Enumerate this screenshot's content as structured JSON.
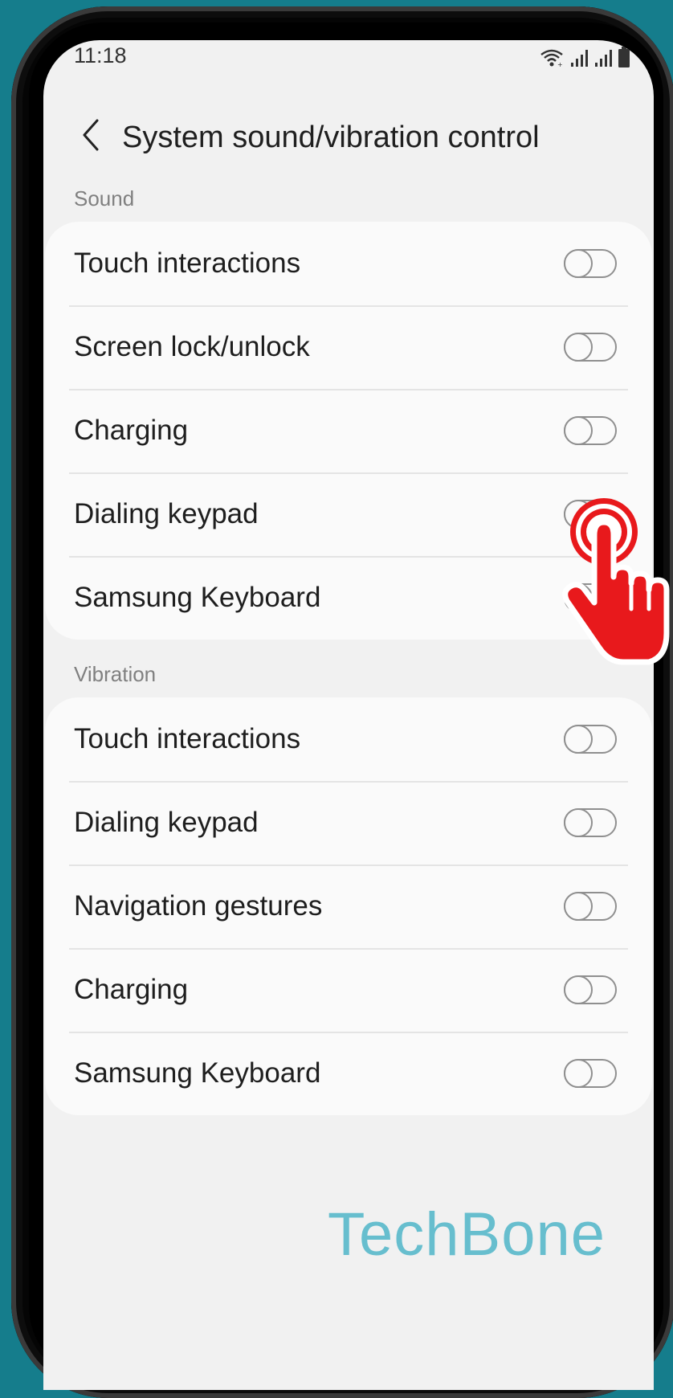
{
  "status_bar": {
    "time": "11:18",
    "icons": [
      "wifi-icon",
      "signal-1-icon",
      "signal-2-icon",
      "battery-icon"
    ]
  },
  "app_bar": {
    "title": "System sound/vibration control",
    "back_icon": "chevron-left-icon"
  },
  "sections": [
    {
      "header": "Sound",
      "items": [
        {
          "label": "Touch interactions",
          "on": false
        },
        {
          "label": "Screen lock/unlock",
          "on": false
        },
        {
          "label": "Charging",
          "on": false
        },
        {
          "label": "Dialing keypad",
          "on": false
        },
        {
          "label": "Samsung Keyboard",
          "on": false
        }
      ]
    },
    {
      "header": "Vibration",
      "items": [
        {
          "label": "Touch interactions",
          "on": false
        },
        {
          "label": "Dialing keypad",
          "on": false
        },
        {
          "label": "Navigation gestures",
          "on": false
        },
        {
          "label": "Charging",
          "on": false
        },
        {
          "label": "Samsung Keyboard",
          "on": false
        }
      ]
    }
  ],
  "watermark": "TechBone",
  "overlay": {
    "icon": "tap-hand-icon",
    "color": "#e8191c"
  },
  "colors": {
    "background": "#157d8c",
    "screen": "#f1f1f1",
    "card": "#fafafa",
    "toggle_off": "#8f8f8f",
    "watermark": "#4fb6c9"
  }
}
